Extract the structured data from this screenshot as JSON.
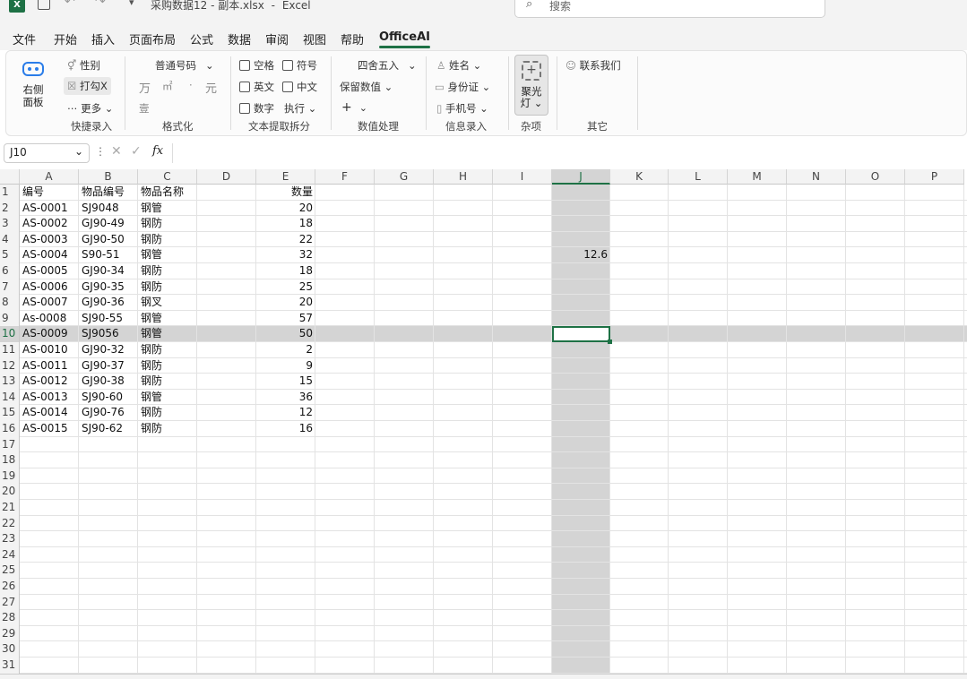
{
  "titlebar": {
    "filename": "采购数据12 - 副本.xlsx",
    "separator": "-",
    "app": "Excel",
    "search_placeholder": "搜索"
  },
  "tabs": [
    "文件",
    "开始",
    "插入",
    "页面布局",
    "公式",
    "数据",
    "审阅",
    "视图",
    "帮助",
    "OfficeAI"
  ],
  "active_tab": "OfficeAI",
  "ribbon": {
    "right_panel": "右侧\n面板",
    "right_panel_l1": "右侧",
    "right_panel_l2": "面板",
    "gender": "性别",
    "mark_x": "打勾X",
    "more": "更多",
    "quick_entry_group": "快捷录入",
    "normal_number": "普通号码",
    "wan": "万",
    "square": "㎡",
    "dot": "·",
    "yuan": "元",
    "capital": "壹",
    "format_group": "格式化",
    "space": "空格",
    "symbol": "符号",
    "english": "英文",
    "chinese": "中文",
    "number": "数字",
    "execute": "执行",
    "text_group": "文本提取拆分",
    "round": "四舍五入",
    "keep_value": "保留数值",
    "plus": "+",
    "number_group": "数值处理",
    "name": "姓名",
    "id_card": "身份证",
    "phone": "手机号",
    "info_group": "信息录入",
    "spotlight_l1": "聚光",
    "spotlight_l2": "灯",
    "misc_group": "杂项",
    "contact": "联系我们",
    "other_group": "其它"
  },
  "formula_bar": {
    "namebox": "J10",
    "fx": "fx",
    "value": ""
  },
  "columns": [
    "A",
    "B",
    "C",
    "D",
    "E",
    "F",
    "G",
    "H",
    "I",
    "J",
    "K",
    "L",
    "M",
    "N",
    "O",
    "P"
  ],
  "selected_column": "J",
  "selected_row": 10,
  "rows": [
    [
      "编号",
      "物品编号",
      "物品名称",
      "",
      "数量"
    ],
    [
      "AS-0001",
      "SJ9048",
      "钢管",
      "",
      "20"
    ],
    [
      "AS-0002",
      "GJ90-49",
      "钢防",
      "",
      "18"
    ],
    [
      "AS-0003",
      "GJ90-50",
      "钢防",
      "",
      "22"
    ],
    [
      "AS-0004",
      "S90-51",
      "钢管",
      "",
      "32"
    ],
    [
      "AS-0005",
      "GJ90-34",
      "钢防",
      "",
      "18"
    ],
    [
      "AS-0006",
      "GJ90-35",
      "钢防",
      "",
      "25"
    ],
    [
      "AS-0007",
      "GJ90-36",
      "钢叉",
      "",
      "20"
    ],
    [
      "As-0008",
      "SJ90-55",
      "钢管",
      "",
      "57"
    ],
    [
      "AS-0009",
      "SJ9056",
      "钢管",
      "",
      "50"
    ],
    [
      "AS-0010",
      "GJ90-32",
      "钢防",
      "",
      "2"
    ],
    [
      "AS-0011",
      "GJ90-37",
      "钢防",
      "",
      "9"
    ],
    [
      "AS-0012",
      "GJ90-38",
      "钢防",
      "",
      "15"
    ],
    [
      "AS-0013",
      "SJ90-60",
      "钢管",
      "",
      "36"
    ],
    [
      "AS-0014",
      "GJ90-76",
      "钢防",
      "",
      "12"
    ],
    [
      "AS-0015",
      "SJ90-62",
      "钢防",
      "",
      "16"
    ]
  ],
  "j5_value": "12.6",
  "row_numbers": [
    "1",
    "2",
    "3",
    "4",
    "5",
    "6",
    "7",
    "8",
    "9",
    "10",
    "11",
    "12",
    "13",
    "14",
    "15",
    "16",
    "17",
    "18",
    "19",
    "20",
    "21",
    "22",
    "23",
    "24",
    "25",
    "26",
    "27",
    "28",
    "29",
    "30",
    "31"
  ],
  "colors": {
    "excel_green": "#1e7145",
    "selection_gray": "#d4d4d4"
  }
}
